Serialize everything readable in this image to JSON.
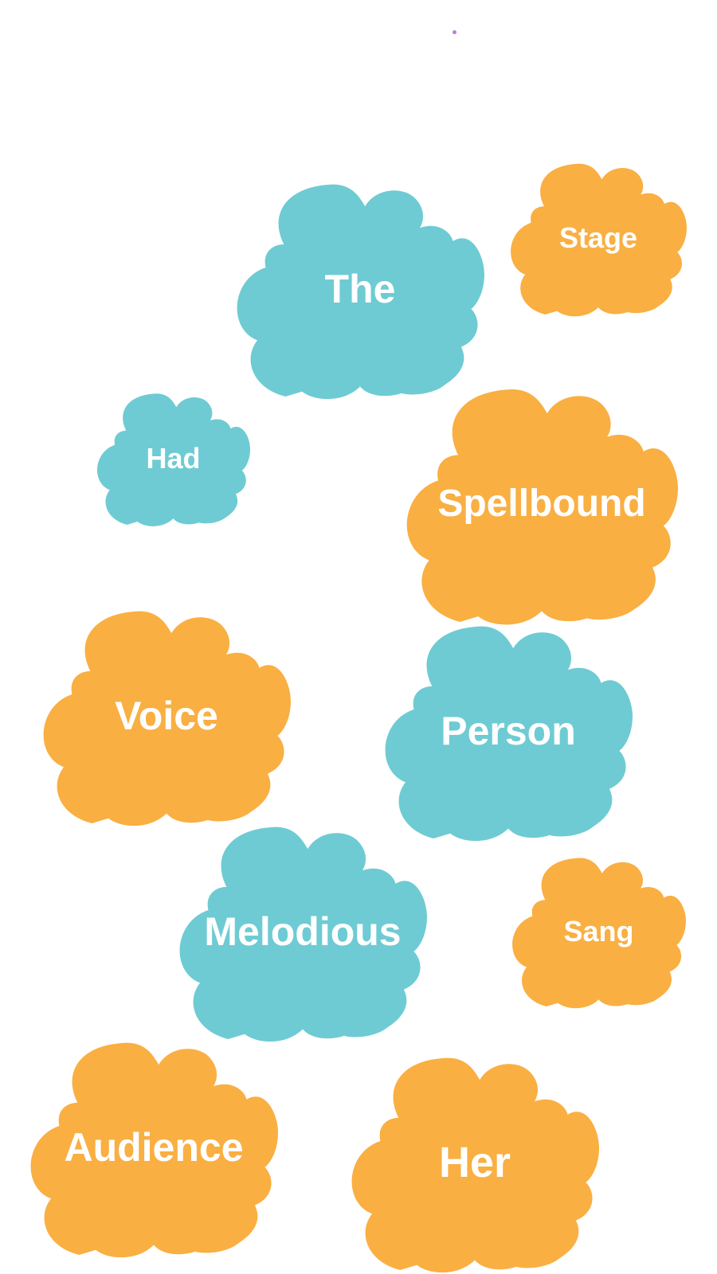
{
  "colors": {
    "teal": "#6ECBD3",
    "orange": "#F9AF42",
    "dot": "#C27BD8",
    "text": "#FFFFFF"
  },
  "words": [
    {
      "id": "the",
      "label": "The",
      "color": "teal"
    },
    {
      "id": "stage",
      "label": "Stage",
      "color": "orange"
    },
    {
      "id": "had",
      "label": "Had",
      "color": "teal"
    },
    {
      "id": "spellbound",
      "label": "Spellbound",
      "color": "orange"
    },
    {
      "id": "voice",
      "label": "Voice",
      "color": "orange"
    },
    {
      "id": "person",
      "label": "Person",
      "color": "teal"
    },
    {
      "id": "melodious",
      "label": "Melodious",
      "color": "teal"
    },
    {
      "id": "sang",
      "label": "Sang",
      "color": "orange"
    },
    {
      "id": "audience",
      "label": "Audience",
      "color": "orange"
    },
    {
      "id": "her",
      "label": "Her",
      "color": "orange"
    }
  ]
}
